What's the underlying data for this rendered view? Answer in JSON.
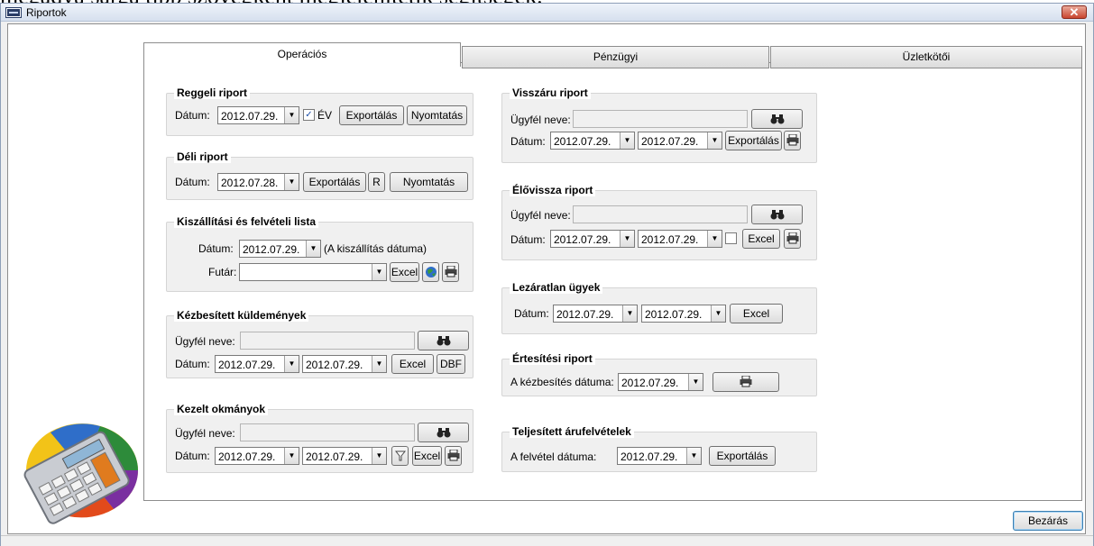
{
  "doc_text": "megadva sárga tipp szövegként megjelenítetik segítségek.",
  "window": {
    "title": "Riportok",
    "close_label": "✕"
  },
  "tabs": [
    {
      "label": "Operációs"
    },
    {
      "label": "Pénzügyi"
    },
    {
      "label": "Üzletkötői"
    }
  ],
  "reggeli": {
    "title": "Reggeli riport",
    "datum_label": "Dátum:",
    "date": "2012.07.29.",
    "ev_checked": "✓",
    "ev_label": "ÉV",
    "export_label": "Exportálás",
    "print_label": "Nyomtatás"
  },
  "deli": {
    "title": "Déli riport",
    "datum_label": "Dátum:",
    "date": "2012.07.28.",
    "export_label": "Exportálás",
    "r_label": "R",
    "print_label": "Nyomtatás"
  },
  "kiszallitasi": {
    "title": "Kiszállítási és felvételi lista",
    "datum_label": "Dátum:",
    "date": "2012.07.29.",
    "note": "(A kiszállítás dátuma)",
    "futar_label": "Futár:",
    "futar_value": "",
    "excel_label": "Excel"
  },
  "kezbesitett": {
    "title": "Kézbesített küldemények",
    "ugyfel_label": "Ügyfél neve:",
    "ugyfel_value": "",
    "datum_label": "Dátum:",
    "date_from": "2012.07.29.",
    "date_to": "2012.07.29.",
    "excel_label": "Excel",
    "dbf_label": "DBF"
  },
  "kezelt": {
    "title": "Kezelt okmányok",
    "ugyfel_label": "Ügyfél neve:",
    "ugyfel_value": "",
    "datum_label": "Dátum:",
    "date_from": "2012.07.29.",
    "date_to": "2012.07.29.",
    "excel_label": "Excel"
  },
  "visszaru": {
    "title": "Visszáru riport",
    "ugyfel_label": "Ügyfél neve:",
    "ugyfel_value": "",
    "datum_label": "Dátum:",
    "date_from": "2012.07.29.",
    "date_to": "2012.07.29.",
    "export_label": "Exportálás"
  },
  "elovissza": {
    "title": "Élővissza riport",
    "ugyfel_label": "Ügyfél neve:",
    "ugyfel_value": "",
    "datum_label": "Dátum:",
    "date_from": "2012.07.29.",
    "date_to": "2012.07.29.",
    "excel_label": "Excel"
  },
  "lezaratlan": {
    "title": "Lezáratlan ügyek",
    "datum_label": "Dátum:",
    "date_from": "2012.07.29.",
    "date_to": "2012.07.29.",
    "excel_label": "Excel"
  },
  "ertesitesi": {
    "title": "Értesítési riport",
    "label": "A kézbesítés dátuma:",
    "date": "2012.07.29."
  },
  "teljesitett": {
    "title": "Teljesített árufelvételek",
    "label": "A felvétel dátuma:",
    "date": "2012.07.29.",
    "export_label": "Exportálás"
  },
  "footer": {
    "close_button": "Bezárás"
  },
  "icons": {
    "binoculars": "binoculars-icon",
    "printer": "printer-icon",
    "globe": "globe-icon",
    "filter": "filter-icon",
    "calculator": "calculator-chart-logo"
  }
}
